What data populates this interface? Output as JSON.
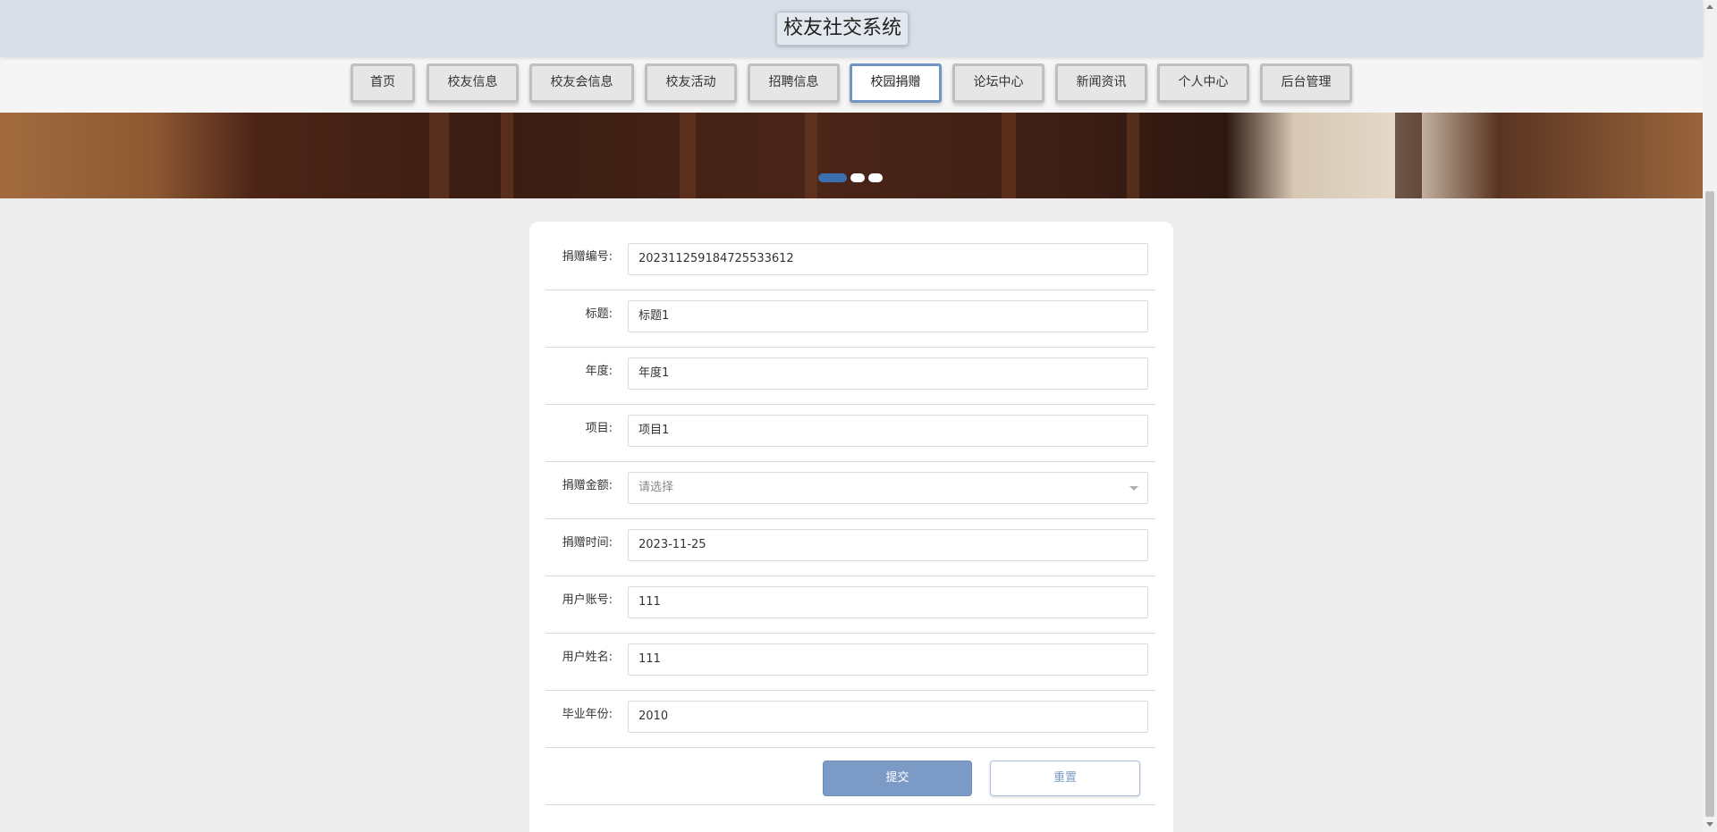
{
  "app": {
    "title": "校友社交系统"
  },
  "nav": [
    {
      "label": "首页"
    },
    {
      "label": "校友信息"
    },
    {
      "label": "校友会信息"
    },
    {
      "label": "校友活动"
    },
    {
      "label": "招聘信息"
    },
    {
      "label": "校园捐赠",
      "active": true
    },
    {
      "label": "论坛中心"
    },
    {
      "label": "新闻资讯"
    },
    {
      "label": "个人中心"
    },
    {
      "label": "后台管理"
    }
  ],
  "carousel": {
    "slides": 3,
    "active_index": 0
  },
  "form": {
    "donation_no": {
      "label": "捐赠编号:",
      "value": "202311259184725533612"
    },
    "title": {
      "label": "标题:",
      "value": "标题1"
    },
    "year": {
      "label": "年度:",
      "value": "年度1"
    },
    "project": {
      "label": "项目:",
      "value": "项目1"
    },
    "amount": {
      "label": "捐赠金额:",
      "placeholder": "请选择"
    },
    "donation_time": {
      "label": "捐赠时间:",
      "value": "2023-11-25"
    },
    "user_account": {
      "label": "用户账号:",
      "value": "111"
    },
    "user_name": {
      "label": "用户姓名:",
      "value": "111"
    },
    "grad_year": {
      "label": "毕业年份:",
      "value": "2010"
    }
  },
  "buttons": {
    "submit": "提交",
    "reset": "重置"
  },
  "colors": {
    "accent": "#7b9ac5",
    "header_bg": "#d7dee8",
    "page_bg": "#ececec"
  }
}
